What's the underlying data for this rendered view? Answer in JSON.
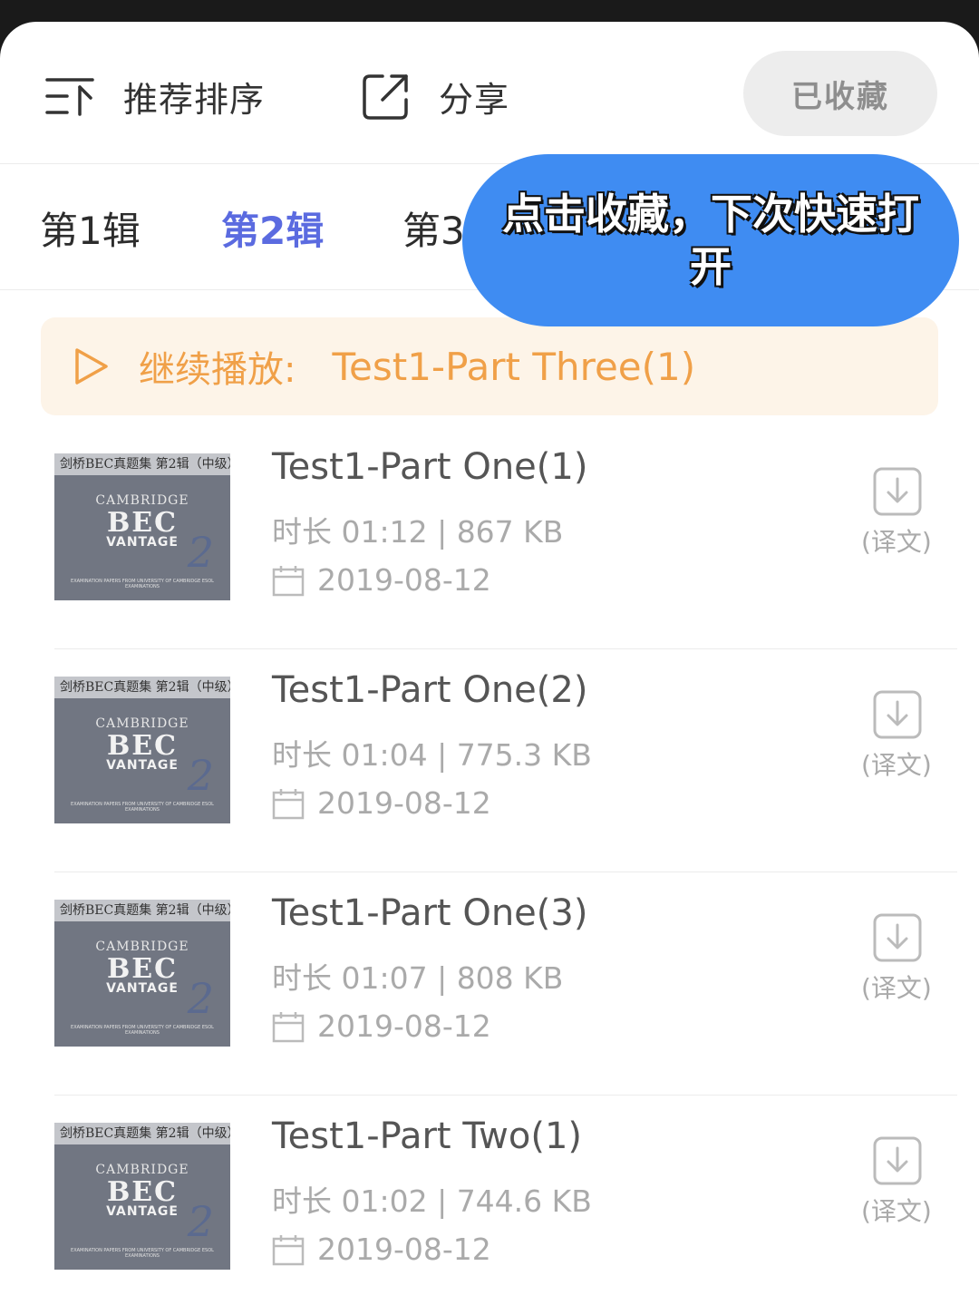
{
  "topbar": {
    "sort_label": "推荐排序",
    "share_label": "分享",
    "favorite_label": "已收藏"
  },
  "tabs": [
    "第1辑",
    "第2辑",
    "第3"
  ],
  "active_tab_index": 1,
  "bubble": {
    "text": "点击收藏，下次快速打开"
  },
  "continue": {
    "label": "继续播放:",
    "track": "Test1-Part Three(1)"
  },
  "cover": {
    "top_text": "剑桥BEC真题集 第2辑（中级）",
    "cambridge": "CAMBRIDGE",
    "bec": "BEC",
    "vantage": "VANTAGE",
    "number": "2",
    "footer": "EXAMINATION PAPERS FROM UNIVERSITY OF CAMBRIDGE ESOL EXAMINATIONS"
  },
  "tracks": [
    {
      "title": "Test1-Part One(1)",
      "meta": "时长 01:12 |  867 KB",
      "date": "2019-08-12",
      "translation": "(译文)"
    },
    {
      "title": "Test1-Part One(2)",
      "meta": "时长 01:04 |  775.3 KB",
      "date": "2019-08-12",
      "translation": "(译文)"
    },
    {
      "title": "Test1-Part One(3)",
      "meta": "时长 01:07 |  808 KB",
      "date": "2019-08-12",
      "translation": "(译文)"
    },
    {
      "title": "Test1-Part Two(1)",
      "meta": "时长 01:02 |  744.6 KB",
      "date": "2019-08-12",
      "translation": "(译文)"
    }
  ],
  "colors": {
    "accent": "#5b6be0",
    "bubble": "#3f8cf2",
    "continue_text": "#f0a048",
    "continue_bg": "#fdf4e8"
  }
}
